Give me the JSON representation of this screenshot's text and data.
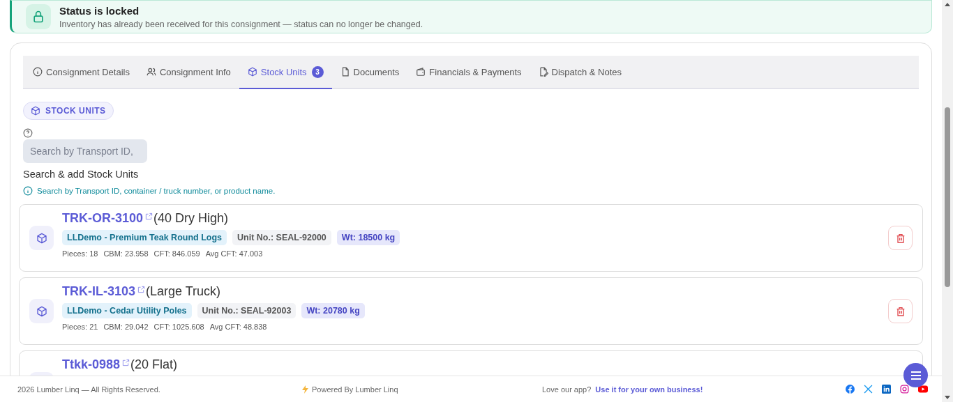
{
  "banner": {
    "title": "Status is locked",
    "message": "Inventory has already been received for this consignment — status can no longer be changed."
  },
  "tabs": [
    {
      "label": "Consignment Details",
      "selected": false
    },
    {
      "label": "Consignment Info",
      "selected": false
    },
    {
      "label": "Stock Units",
      "selected": true,
      "badge": "3"
    },
    {
      "label": "Documents",
      "selected": false
    },
    {
      "label": "Financials & Payments",
      "selected": false
    },
    {
      "label": "Dispatch & Notes",
      "selected": false
    }
  ],
  "section_chip": "STOCK UNITS",
  "search": {
    "placeholder": "Search by Transport ID,",
    "label": "Search & add Stock Units",
    "hint": "Search by Transport ID, container / truck number, or product name."
  },
  "stock_units": [
    {
      "transport_id": "TRK-OR-3100",
      "vehicle_type": "(40 Dry High)",
      "product": "LLDemo - Premium Teak Round Logs",
      "unit_no": "Unit No.: SEAL-92000",
      "weight": "Wt: 18500 kg",
      "metrics": [
        "Pieces: 18",
        "CBM: 23.958",
        "CFT: 846.059",
        "Avg CFT: 47.003"
      ]
    },
    {
      "transport_id": "TRK-IL-3103",
      "vehicle_type": "(Large Truck)",
      "product": "LLDemo - Cedar Utility Poles",
      "unit_no": "Unit No.: SEAL-92003",
      "weight": "Wt: 20780 kg",
      "metrics": [
        "Pieces: 21",
        "CBM: 29.042",
        "CFT: 1025.608",
        "Avg CFT: 48.838"
      ]
    },
    {
      "transport_id": "Ttkk-0988",
      "vehicle_type": "(20 Flat)"
    }
  ],
  "footer": {
    "copyright": "2026 Lumber Linq — All Rights Reserved.",
    "powered_by": "Powered By Lumber Linq",
    "love_prompt": "Love our app?",
    "love_link": "Use it for your own business!"
  }
}
